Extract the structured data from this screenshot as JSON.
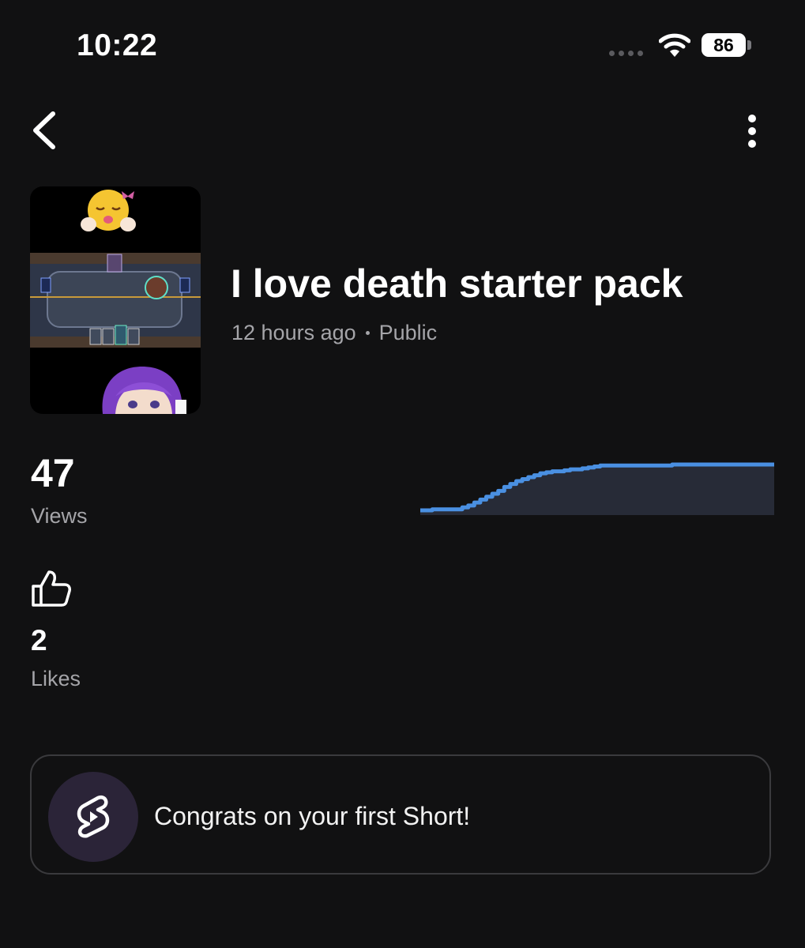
{
  "status_bar": {
    "time": "10:22",
    "battery": "86",
    "icons": [
      "signal-dots-icon",
      "wifi-icon",
      "battery-icon"
    ]
  },
  "nav": {
    "icons": [
      "chevron-left-icon",
      "more-vertical-icon"
    ]
  },
  "video": {
    "title": "I love death starter pack",
    "age": "12 hours ago",
    "visibility": "Public"
  },
  "views": {
    "count": "47",
    "label": "Views"
  },
  "likes": {
    "count": "2",
    "label": "Likes",
    "icon": "thumbs-up-icon"
  },
  "congrats": {
    "text": "Congrats on your first Short!",
    "icon": "shorts-logo-icon"
  },
  "colors": {
    "background": "#111112",
    "chart_line": "#4a90e2",
    "chart_fill": "#272b37",
    "secondary_text": "#a5a5a9",
    "card_border": "#3a3a3d",
    "card_icon_bg": "#2b2438"
  },
  "chart_data": {
    "type": "area",
    "values": [
      0,
      0,
      1,
      1,
      1,
      1,
      1,
      3,
      5,
      8,
      11,
      14,
      17,
      20,
      24,
      27,
      30,
      32,
      34,
      36,
      38,
      39,
      40,
      40,
      41,
      42,
      42,
      43,
      44,
      45,
      46,
      46,
      46,
      46,
      46,
      46,
      46,
      46,
      46,
      46,
      46,
      46,
      47,
      47,
      47,
      47,
      47,
      47,
      47,
      47,
      47,
      47,
      47,
      47,
      47,
      47,
      47,
      47,
      47,
      47
    ],
    "ylim": [
      0,
      47
    ],
    "grid": false
  }
}
